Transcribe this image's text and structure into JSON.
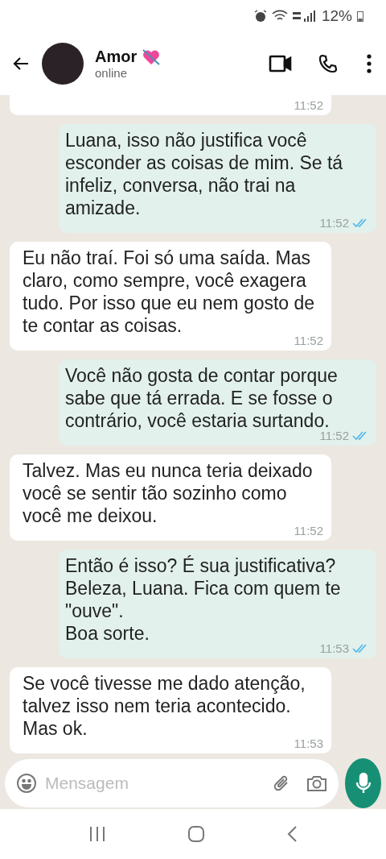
{
  "status_bar": {
    "battery": "12%"
  },
  "header": {
    "name": "Amor",
    "status": "online"
  },
  "messages": [
    {
      "kind": "received",
      "time": "11:52"
    },
    {
      "kind": "sent",
      "text": "Luana, isso não justifica você esconder as coisas de mim. Se tá infeliz, conversa, não trai na amizade.",
      "time": "11:52",
      "read": true
    },
    {
      "kind": "received",
      "text": "Eu não traí. Foi só uma saída. Mas claro, como sempre, você exagera tudo. Por isso que eu nem gosto de te contar as coisas.",
      "time": "11:52"
    },
    {
      "kind": "sent",
      "text": "Você não gosta de contar porque sabe que tá errada. E se fosse o contrário, você estaria surtando.",
      "time": "11:52",
      "read": true
    },
    {
      "kind": "received",
      "text": "Talvez. Mas eu nunca teria deixado você se sentir tão sozinho como você me deixou.",
      "time": "11:52"
    },
    {
      "kind": "sent",
      "text": "Então é isso? É sua justificativa? Beleza, Luana. Fica com quem te \"ouve\".\nBoa sorte.",
      "time": "11:53",
      "read": true
    },
    {
      "kind": "received",
      "text": "Se você tivesse me dado atenção, talvez isso nem teria acontecido.\nMas ok.",
      "time": "11:53"
    }
  ],
  "composer": {
    "placeholder": "Mensagem"
  }
}
